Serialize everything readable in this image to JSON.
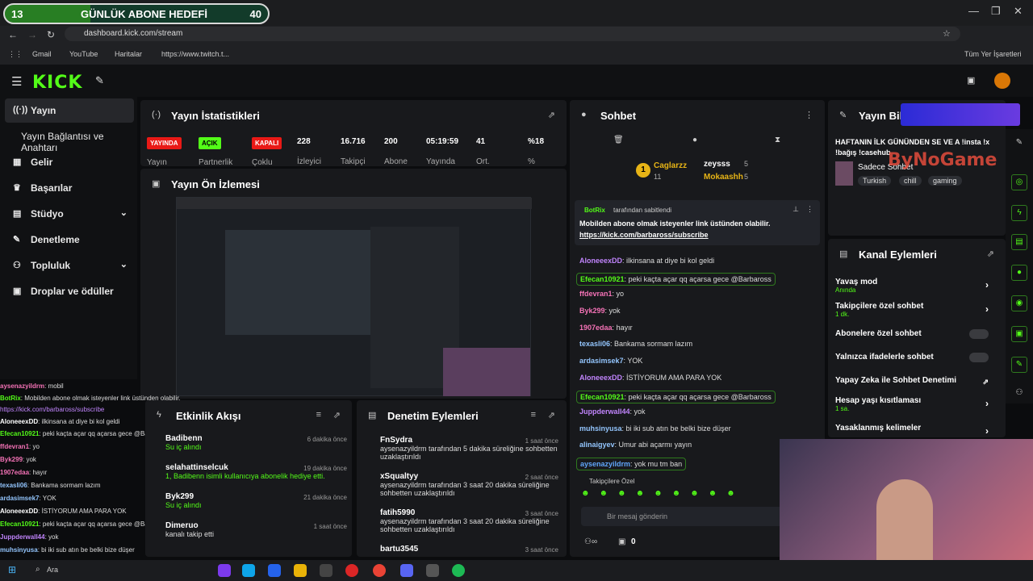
{
  "browser": {
    "goal": {
      "current": "13",
      "title": "GÜNLÜK ABONE HEDEFİ",
      "target": "40",
      "progress": 0.325
    },
    "url": "dashboard.kick.com/stream",
    "bookmarks": [
      "Gmail",
      "YouTube",
      "Haritalar",
      "https://www.twitch.t...",
      "Tüm Yer İşaretleri"
    ]
  },
  "sidebar": {
    "items": [
      {
        "label": "Yayın",
        "icon": "broadcast-icon"
      },
      {
        "label": "Yayın Bağlantısı ve Anahtarı",
        "icon": ""
      },
      {
        "label": "Gelir",
        "icon": "revenue-icon"
      },
      {
        "label": "Başarılar",
        "icon": "trophy-icon"
      },
      {
        "label": "Stüdyo",
        "icon": "studio-icon"
      },
      {
        "label": "Denetleme",
        "icon": "wrench-icon"
      },
      {
        "label": "Topluluk",
        "icon": "community-icon"
      },
      {
        "label": "Droplar ve ödüller",
        "icon": "gift-icon"
      }
    ]
  },
  "stats": {
    "title": "Yayın İstatistikleri",
    "badges": [
      {
        "label": "YAYINDA",
        "caption": "Yayın",
        "color": "#e91916"
      },
      {
        "label": "AÇIK",
        "caption": "Partnerlik",
        "color": "#53fc18"
      },
      {
        "label": "KAPALI",
        "caption": "Çoklu",
        "color": "#e91916"
      }
    ],
    "values": [
      {
        "v": "228",
        "l": "İzleyici"
      },
      {
        "v": "16.716",
        "l": "Takipçi"
      },
      {
        "v": "200",
        "l": "Abone"
      },
      {
        "v": "05:19:59",
        "l": "Yayında"
      },
      {
        "v": "41",
        "l": "Ort."
      },
      {
        "v": "%18",
        "l": "%"
      }
    ]
  },
  "preview": {
    "title": "Yayın Ön İzlemesi"
  },
  "feed": {
    "title": "Etkinlik Akışı",
    "rows": [
      {
        "user": "Badibenn",
        "text": "Su iç alındı",
        "time": "6 dakika önce"
      },
      {
        "user": "selahattinselcuk",
        "text": "1, Badibenn isimli kullanıcıya abonelik hediye etti.",
        "time": "19 dakika önce"
      },
      {
        "user": "Byk299",
        "text": "Su iç alındı",
        "time": "21 dakika önce"
      },
      {
        "user": "Dimeruo",
        "text": "kanalı takip etti",
        "time": "1 saat önce"
      }
    ]
  },
  "moderation": {
    "title": "Denetim Eylemleri",
    "rows": [
      {
        "user": "FnSydra",
        "text": "aysenazyildrm tarafından 5 dakika süreliğine sohbetten uzaklaştırıldı",
        "time": "1 saat önce"
      },
      {
        "user": "xSqualtyy",
        "text": "aysenazyildrm tarafından 3 saat 20 dakika süreliğine sohbetten uzaklaştırıldı",
        "time": "2 saat önce"
      },
      {
        "user": "fatih5990",
        "text": "aysenazyildrm tarafından 3 saat 20 dakika süreliğine sohbetten uzaklaştırıldı",
        "time": "3 saat önce"
      },
      {
        "user": "bartu3545",
        "text": "",
        "time": "3 saat önce"
      }
    ]
  },
  "chat": {
    "title": "Sohbet",
    "leaders": [
      {
        "name": "Caglarzz",
        "count": "11"
      },
      {
        "name": "zeysss",
        "count": "5"
      },
      {
        "name": "Mokaashh",
        "count": "5"
      }
    ],
    "pinned": {
      "by": "BotRix",
      "by_suffix": "tarafından sabitlendi",
      "text": "Mobilden abone olmak isteyenler link üstünden olabilir.",
      "link": "https://kick.com/barbaross/subscribe"
    },
    "messages": [
      {
        "user": "AloneeexDD",
        "text": "ilkinsana at diye bi kol geldi",
        "color": "#c084fc",
        "hl": false
      },
      {
        "user": "Efecan10921",
        "text": "peki kaçta açar qq açarsa gece @Barbaross",
        "color": "#53fc18",
        "hl": true
      },
      {
        "user": "ffdevran1",
        "text": "yo",
        "color": "#f472b6",
        "hl": false
      },
      {
        "user": "Byk299",
        "text": "yok",
        "color": "#f472b6",
        "hl": false
      },
      {
        "user": "1907edaa",
        "text": "hayır",
        "color": "#f472b6",
        "hl": false
      },
      {
        "user": "texasli06",
        "text": "Bankama sormam lazım",
        "color": "#93c5fd",
        "hl": false
      },
      {
        "user": "ardasimsek7",
        "text": "YOK",
        "color": "#93c5fd",
        "hl": false
      },
      {
        "user": "AloneeexDD",
        "text": "İSTİYORUM AMA PARA YOK",
        "color": "#c084fc",
        "hl": false
      },
      {
        "user": "Efecan10921",
        "text": "peki kaçta açar qq açarsa gece @Barbaross",
        "color": "#53fc18",
        "hl": true
      },
      {
        "user": "Juppderwall44",
        "text": "yok",
        "color": "#c084fc",
        "hl": false
      },
      {
        "user": "muhsinyusa",
        "text": "bi iki sub atın be belki bize düşer",
        "color": "#93c5fd",
        "hl": false
      },
      {
        "user": "alinaigyev",
        "text": "Umur abi açarmı yayın",
        "color": "#93c5fd",
        "hl": false
      },
      {
        "user": "aysenazyildrm",
        "text": "yok mu tm ban",
        "color": "#60a5fa",
        "hl": true
      }
    ],
    "followers_only": "Takipçilere Özel",
    "input_placeholder": "Bir mesaj gönderin",
    "points": "0"
  },
  "stream_info": {
    "title": "Yayın Bilgisi",
    "headline": "HAFTANIN İLK GÜNÜNDEN SE VE A !insta !x !bağış !casehub",
    "category": "Sadece Sohbet",
    "tags": [
      "Turkish",
      "chill",
      "gaming"
    ]
  },
  "channel_actions": {
    "title": "Kanal Eylemleri",
    "items": [
      {
        "label": "Yavaş mod",
        "sub": "Anında",
        "type": "arrow"
      },
      {
        "label": "Takipçilere özel sohbet",
        "sub": "1 dk.",
        "type": "arrow"
      },
      {
        "label": "Abonelere özel sohbet",
        "sub": "",
        "type": "toggle"
      },
      {
        "label": "Yalnızca ifadelerle sohbet",
        "sub": "",
        "type": "toggle"
      },
      {
        "label": "Yapay Zeka ile Sohbet Denetimi",
        "sub": "",
        "type": "ext"
      },
      {
        "label": "Hesap yaşı kısıtlaması",
        "sub": "1 sa.",
        "type": "arrow"
      },
      {
        "label": "Yasaklanmış kelimeler",
        "sub": "",
        "type": "arrow"
      }
    ]
  },
  "overlay_chat": [
    {
      "user": "aysenazyildrm",
      "text": ": mobil"
    },
    {
      "user": "BotRix",
      "text": ": Mobilden abone olmak isteyenler link üstünden olabilir."
    },
    {
      "user": "",
      "text": "https://kick.com/barbaross/subscribe"
    },
    {
      "user": "AloneeexDD",
      "text": ": ilkinsana at diye bi kol geldi"
    },
    {
      "user": "Efecan10921",
      "text": ": peki kaçta açar qq açarsa gece @Barbaross"
    },
    {
      "user": "ffdevran1",
      "text": ": yo"
    },
    {
      "user": "Byk299",
      "text": ": yok"
    },
    {
      "user": "1907edaa",
      "text": ": hayır"
    },
    {
      "user": "texasli06",
      "text": ": Bankama sormam lazım"
    },
    {
      "user": "ardasimsek7",
      "text": ": YOK"
    },
    {
      "user": "AloneeexDD",
      "text": ": İSTİYORUM AMA PARA YOK"
    },
    {
      "user": "Efecan10921",
      "text": ": peki kaçta açar qq açarsa gece @Barbaross"
    },
    {
      "user": "Juppderwall44",
      "text": ": yok"
    },
    {
      "user": "muhsinyusa",
      "text": ": bi iki sub atın be belki bize düşer"
    },
    {
      "user": "alinaigyev",
      "text": ": Umur abi açarmı yayın"
    },
    {
      "user": "aysenazyildrm",
      "text": ": yok mu tm ban"
    }
  ],
  "watermark": "ByNoGame",
  "taskbar": {
    "search": "Ara"
  }
}
